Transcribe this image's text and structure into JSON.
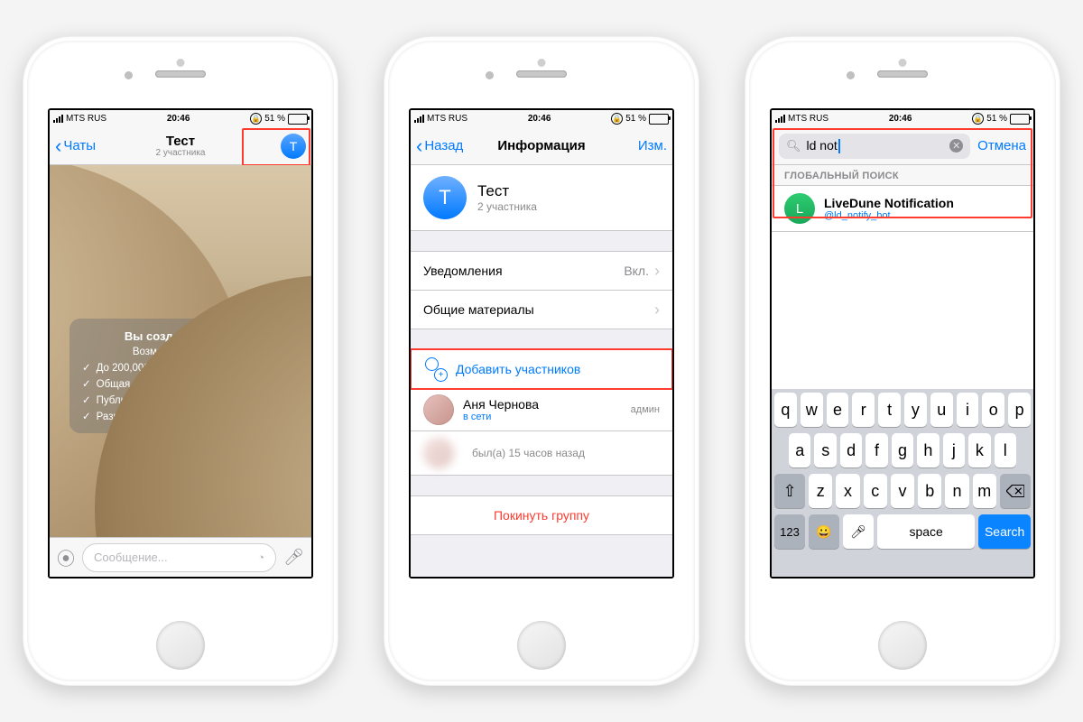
{
  "status": {
    "carrier": "MTS RUS",
    "time": "20:46",
    "battery": "51 %"
  },
  "screen1": {
    "back": "Чаты",
    "title": "Тест",
    "subtitle": "2 участника",
    "avatar_letter": "T",
    "bubble_title": "Вы создали группу",
    "bubble_sub": "Возможности групп:",
    "features": [
      "До 200,000 участников",
      "Общая история переписки",
      "Публичные ссылки вида t.me/title",
      "Разный уровень прав"
    ],
    "compose_placeholder": "Сообщение..."
  },
  "screen2": {
    "back": "Назад",
    "title": "Информация",
    "edit": "Изм.",
    "group_name": "Тест",
    "group_sub": "2 участника",
    "avatar_letter": "T",
    "notifications_label": "Уведомления",
    "notifications_value": "Вкл.",
    "shared_label": "Общие материалы",
    "add_member": "Добавить участников",
    "member_name": "Аня Чернова",
    "member_status": "в сети",
    "member_role": "админ",
    "hidden_status": "был(а) 15 часов назад",
    "leave": "Покинуть группу"
  },
  "screen3": {
    "query": "ld not",
    "cancel": "Отмена",
    "section": "ГЛОБАЛЬНЫЙ ПОИСК",
    "result_avatar": "L",
    "result_name": "LiveDune Notification",
    "result_handle": "@ld_notify_bot",
    "keyboard": {
      "row1": [
        "q",
        "w",
        "e",
        "r",
        "t",
        "y",
        "u",
        "i",
        "o",
        "p"
      ],
      "row2": [
        "a",
        "s",
        "d",
        "f",
        "g",
        "h",
        "j",
        "k",
        "l"
      ],
      "row3": [
        "z",
        "x",
        "c",
        "v",
        "b",
        "n",
        "m"
      ],
      "shift": "⇧",
      "num": "123",
      "emoji": "😀",
      "space": "space",
      "search": "Search"
    }
  }
}
